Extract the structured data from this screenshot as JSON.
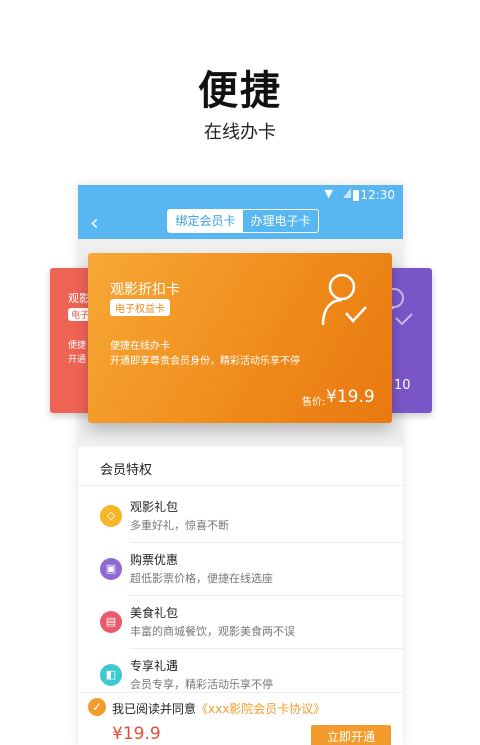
{
  "hero": {
    "title": "便捷",
    "subtitle": "在线办卡"
  },
  "status_bar": {
    "time": "12:30"
  },
  "nav": {
    "tabs": [
      {
        "label": "绑定会员卡",
        "active": true
      },
      {
        "label": "办理电子卡",
        "active": false
      }
    ]
  },
  "left_card": {
    "title": "观影",
    "badge": "电子",
    "line1": "便捷",
    "line2": "开通"
  },
  "main_card": {
    "title": "观影折扣卡",
    "badge": "电子权益卡",
    "desc_line1": "便捷在线办卡",
    "desc_line2": "开通即享尊贵会员身份，精彩活动乐享不停",
    "price_label": "售价:",
    "price": "¥19.9",
    "color": "#ef8a1a"
  },
  "right_card": {
    "price_fragment": "10",
    "color": "#7a55c8"
  },
  "benefits": {
    "title": "会员特权",
    "items": [
      {
        "icon": "gift-icon",
        "icon_glyph": "♢",
        "color": "#f5b62a",
        "title": "观影礼包",
        "desc": "多重好礼，惊喜不断"
      },
      {
        "icon": "ticket-icon",
        "icon_glyph": "▣",
        "color": "#8e6bd0",
        "title": "购票优惠",
        "desc": "超低影票价格，便捷在线选座"
      },
      {
        "icon": "basket-icon",
        "icon_glyph": "▤",
        "color": "#ea5a6a",
        "title": "美食礼包",
        "desc": "丰富的商城餐饮，观影美食两不误"
      },
      {
        "icon": "present-icon",
        "icon_glyph": "◧",
        "color": "#3ccad0",
        "title": "专享礼遇",
        "desc": "会员专享，精彩活动乐享不停"
      }
    ]
  },
  "agreement": {
    "text": "我已阅读并同意",
    "link": "《xxx影院会员卡协议》"
  },
  "bottom": {
    "price": "¥19.9",
    "button": "立即开通"
  },
  "colors": {
    "accent": "#58b7f0",
    "orange": "#f39c2d"
  }
}
